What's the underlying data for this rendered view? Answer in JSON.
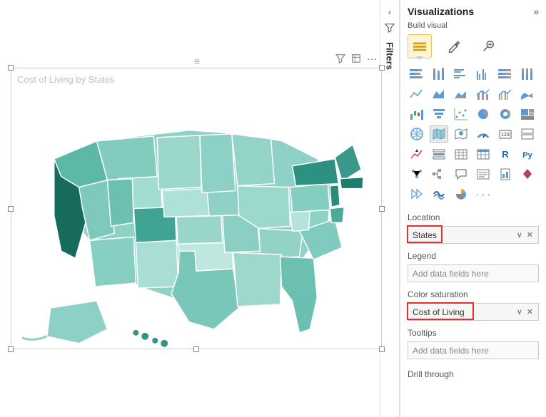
{
  "canvas": {
    "viz_title": "Cost of Living by States"
  },
  "filters_pane": {
    "label": "Filters"
  },
  "viz_pane": {
    "title": "Visualizations",
    "subhead": "Build visual",
    "gallery_more": "· · ·",
    "sections": {
      "location": {
        "label": "Location",
        "field": "States"
      },
      "legend": {
        "label": "Legend",
        "placeholder": "Add data fields here"
      },
      "color_sat": {
        "label": "Color saturation",
        "field": "Cost of Living"
      },
      "tooltips": {
        "label": "Tooltips",
        "placeholder": "Add data fields here"
      },
      "drill": {
        "label": "Drill through"
      }
    }
  }
}
